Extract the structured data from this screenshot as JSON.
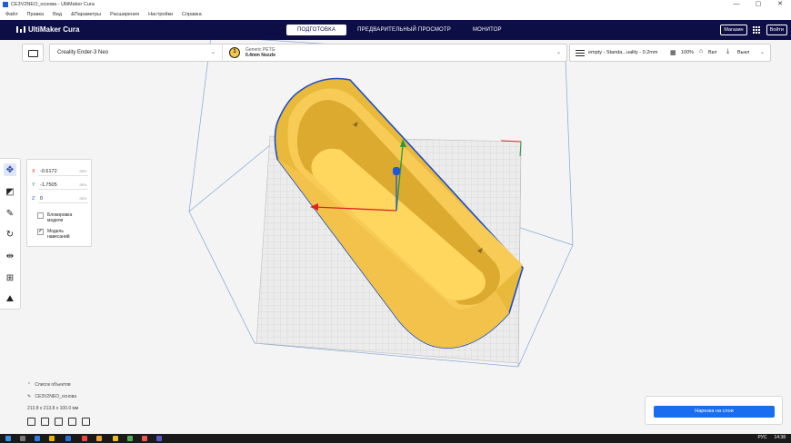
{
  "window": {
    "title": "CE3V2NEO_основа - UltiMaker Cura",
    "controls": [
      "—",
      "▢",
      "✕"
    ]
  },
  "menu": [
    "Файл",
    "Правка",
    "Вид",
    "&Параметры",
    "Расширения",
    "Настройки",
    "Справка"
  ],
  "header": {
    "logo": "UltiMaker Cura",
    "stages": [
      "ПОДГОТОВКА",
      "ПРЕДВАРИТЕЛЬНЫЙ ПРОСМОТР",
      "МОНИТОР"
    ],
    "active_stage": "ПОДГОТОВКА",
    "marketplace": "Магазин",
    "signin": "Войти"
  },
  "printer": {
    "name": "Creality Ender-3 Neo",
    "extruder_number": "1",
    "material": "Generic PETG",
    "nozzle": "0.4mm Nozzle"
  },
  "print_settings": {
    "profile": "empty - Standa...uality - 0.2mm",
    "infill": "100%",
    "support": "Вкл",
    "adhesion": "Выкл"
  },
  "move_panel": {
    "x_label": "X",
    "x_value": "-0.6172",
    "y_label": "Y",
    "y_value": "-1.7505",
    "z_label": "Z",
    "z_value": "0",
    "unit": "mm",
    "lock_model_label": "Блокировка модели",
    "lock_model_checked": false,
    "drop_down_label": "Модель навесаний",
    "drop_down_checked": true
  },
  "object_list": {
    "header": "Список объектов",
    "object_name": "CE3V2NEO_основа",
    "dimensions": "213.8 x 213.8 x 100.0 мм"
  },
  "slice_button": "Нарезка на слои",
  "taskbar": {
    "language": "РУС",
    "time": "14:38"
  },
  "colors": {
    "header_bg": "#0e0e47",
    "accent_blue": "#196ef0",
    "model_yellow": "#f7c948",
    "model_edge": "#1f4fc4"
  }
}
